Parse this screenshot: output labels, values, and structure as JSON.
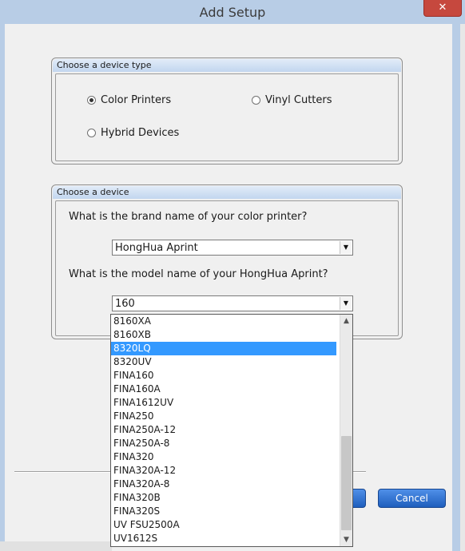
{
  "window": {
    "title": "Add Setup",
    "close_glyph": "✕"
  },
  "device_type": {
    "header": "Choose a device type",
    "options": [
      {
        "label": "Color Printers",
        "selected": true
      },
      {
        "label": "Vinyl Cutters",
        "selected": false
      },
      {
        "label": "Hybrid Devices",
        "selected": false
      }
    ]
  },
  "device": {
    "header": "Choose a device",
    "brand_question": "What is the brand name of your color printer?",
    "brand_value": "HongHua Aprint",
    "model_question": "What is the model name of your HongHua Aprint?",
    "model_value": "160",
    "model_list": [
      "8160XA",
      "8160XB",
      "8320LQ",
      "8320UV",
      "FINA160",
      "FINA160A",
      "FINA1612UV",
      "FINA250",
      "FINA250A-12",
      "FINA250A-8",
      "FINA320",
      "FINA320A-12",
      "FINA320A-8",
      "FINA320B",
      "FINA320S",
      "UV FSU2500A",
      "UV1612S"
    ],
    "highlighted_model": "8320LQ"
  },
  "buttons": {
    "cancel": "Cancel"
  },
  "icons": {
    "dropdown_arrow": "chevron-down-icon",
    "scroll_up": "chevron-up-icon",
    "scroll_down": "chevron-down-icon"
  },
  "colors": {
    "accent": "#3399ff",
    "button": "#2b6fd3",
    "close": "#c6483e",
    "titlebar": "#b8cde6"
  }
}
